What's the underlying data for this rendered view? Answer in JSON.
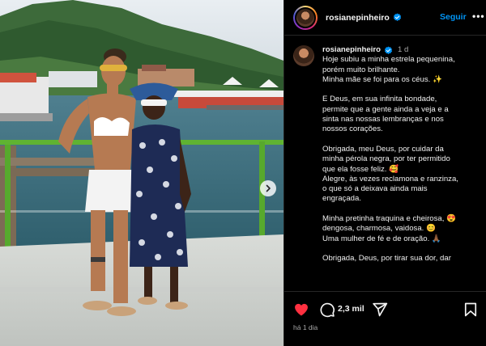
{
  "header": {
    "username": "rosianepinheiro",
    "verified": true,
    "follow_label": "Seguir",
    "more_label": "•••"
  },
  "caption": {
    "username": "rosianepinheiro",
    "time": "1 d",
    "lines": [
      "Hoje subiu a minha estrela pequenina,",
      "porém muito brilhante.",
      "Minha mãe se foi para os céus. ✨",
      "",
      "E Deus, em sua infinita bondade,",
      "permite que a gente ainda a veja e a",
      "sinta nas nossas lembranças e nos",
      "nossos corações.",
      "",
      "Obrigada, meu Deus, por cuidar da",
      "minha pérola negra, por ter permitido",
      "que ela fosse feliz. 🥰",
      "Alegre, às vezes reclamona e ranzinza,",
      "o que só a deixava ainda mais",
      "engraçada.",
      "",
      "Minha pretinha traquina e cheirosa, 😍",
      "dengosa, charmosa, vaidosa. 😊",
      "Uma mulher de fé e de oração. 🙏🏾",
      "",
      "Obrigada, Deus, por tirar sua dor, dar"
    ]
  },
  "actions": {
    "comment_count": "2,3 mil",
    "post_time": "há 1 dia"
  },
  "icons": {
    "like": "heart-filled-icon",
    "comment": "comment-icon",
    "share": "send-icon",
    "save": "bookmark-icon",
    "carousel_next": "chevron-right-icon",
    "verified": "verified-badge-icon"
  },
  "colors": {
    "like_red": "#ff3040",
    "follow_blue": "#0095f6",
    "verified_blue": "#0095f6",
    "background": "#000000"
  }
}
